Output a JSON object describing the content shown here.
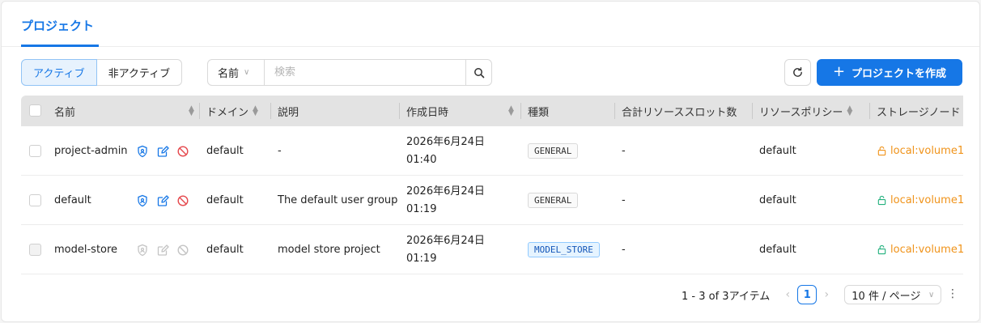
{
  "tabs": {
    "active": "プロジェクト"
  },
  "filter": {
    "active_label": "アクティブ",
    "inactive_label": "非アクティブ"
  },
  "search": {
    "field": "名前",
    "placeholder": "検索"
  },
  "toolbar": {
    "create_label": "プロジェクトを作成"
  },
  "columns": [
    "名前",
    "ドメイン",
    "説明",
    "作成日時",
    "種類",
    "合計リソーススロット数",
    "リソースポリシー",
    "ストレージノード"
  ],
  "rows": [
    {
      "name": "project-admin",
      "domain": "default",
      "description": "-",
      "date": "2026年6月24日",
      "time": "01:40",
      "type": "GENERAL",
      "slots": "-",
      "policy": "default",
      "storage": "local:volume1",
      "actions_enabled": true
    },
    {
      "name": "default",
      "domain": "default",
      "description": "The default user group",
      "date": "2026年6月24日",
      "time": "01:19",
      "type": "GENERAL",
      "slots": "-",
      "policy": "default",
      "storage": "local:volume1",
      "actions_enabled": true
    },
    {
      "name": "model-store",
      "domain": "default",
      "description": "model store project",
      "date": "2026年6月24日",
      "time": "01:19",
      "type": "MODEL_STORE",
      "slots": "-",
      "policy": "default",
      "storage": "local:volume1",
      "actions_enabled": false
    }
  ],
  "pagination": {
    "summary": "1 - 3 of 3アイテム",
    "current": "1",
    "page_size": "10 件 / ページ"
  },
  "colors": {
    "primary": "#1677e6",
    "danger": "#e5484d",
    "storage": "#f0931a",
    "green": "#22b07d"
  },
  "icons": {
    "shield": "shield-icon",
    "edit": "edit-icon",
    "ban": "ban-icon",
    "lock": "lock-open-icon",
    "search": "search-icon",
    "refresh": "refresh-icon"
  }
}
